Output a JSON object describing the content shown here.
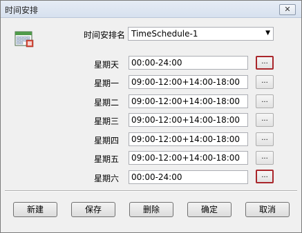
{
  "window": {
    "title": "时间安排",
    "close_label": "✕"
  },
  "schedule_name": {
    "label": "时间安排名",
    "value": "TimeSchedule-1",
    "arrow": "▼"
  },
  "days": [
    {
      "label": "星期天",
      "value": "00:00-24:00",
      "button": "..."
    },
    {
      "label": "星期一",
      "value": "09:00-12:00+14:00-18:00",
      "button": "..."
    },
    {
      "label": "星期二",
      "value": "09:00-12:00+14:00-18:00",
      "button": "..."
    },
    {
      "label": "星期三",
      "value": "09:00-12:00+14:00-18:00",
      "button": "..."
    },
    {
      "label": "星期四",
      "value": "09:00-12:00+14:00-18:00",
      "button": "..."
    },
    {
      "label": "星期五",
      "value": "09:00-12:00+14:00-18:00",
      "button": "..."
    },
    {
      "label": "星期六",
      "value": "00:00-24:00",
      "button": "..."
    }
  ],
  "buttons": {
    "new": "新建",
    "save": "保存",
    "delete": "删除",
    "ok": "确定",
    "cancel": "取消"
  },
  "colors": {
    "highlight_border": "#a9262b",
    "titlebar": "#dde6f2"
  },
  "icons": {
    "app": "calendar-icon"
  }
}
